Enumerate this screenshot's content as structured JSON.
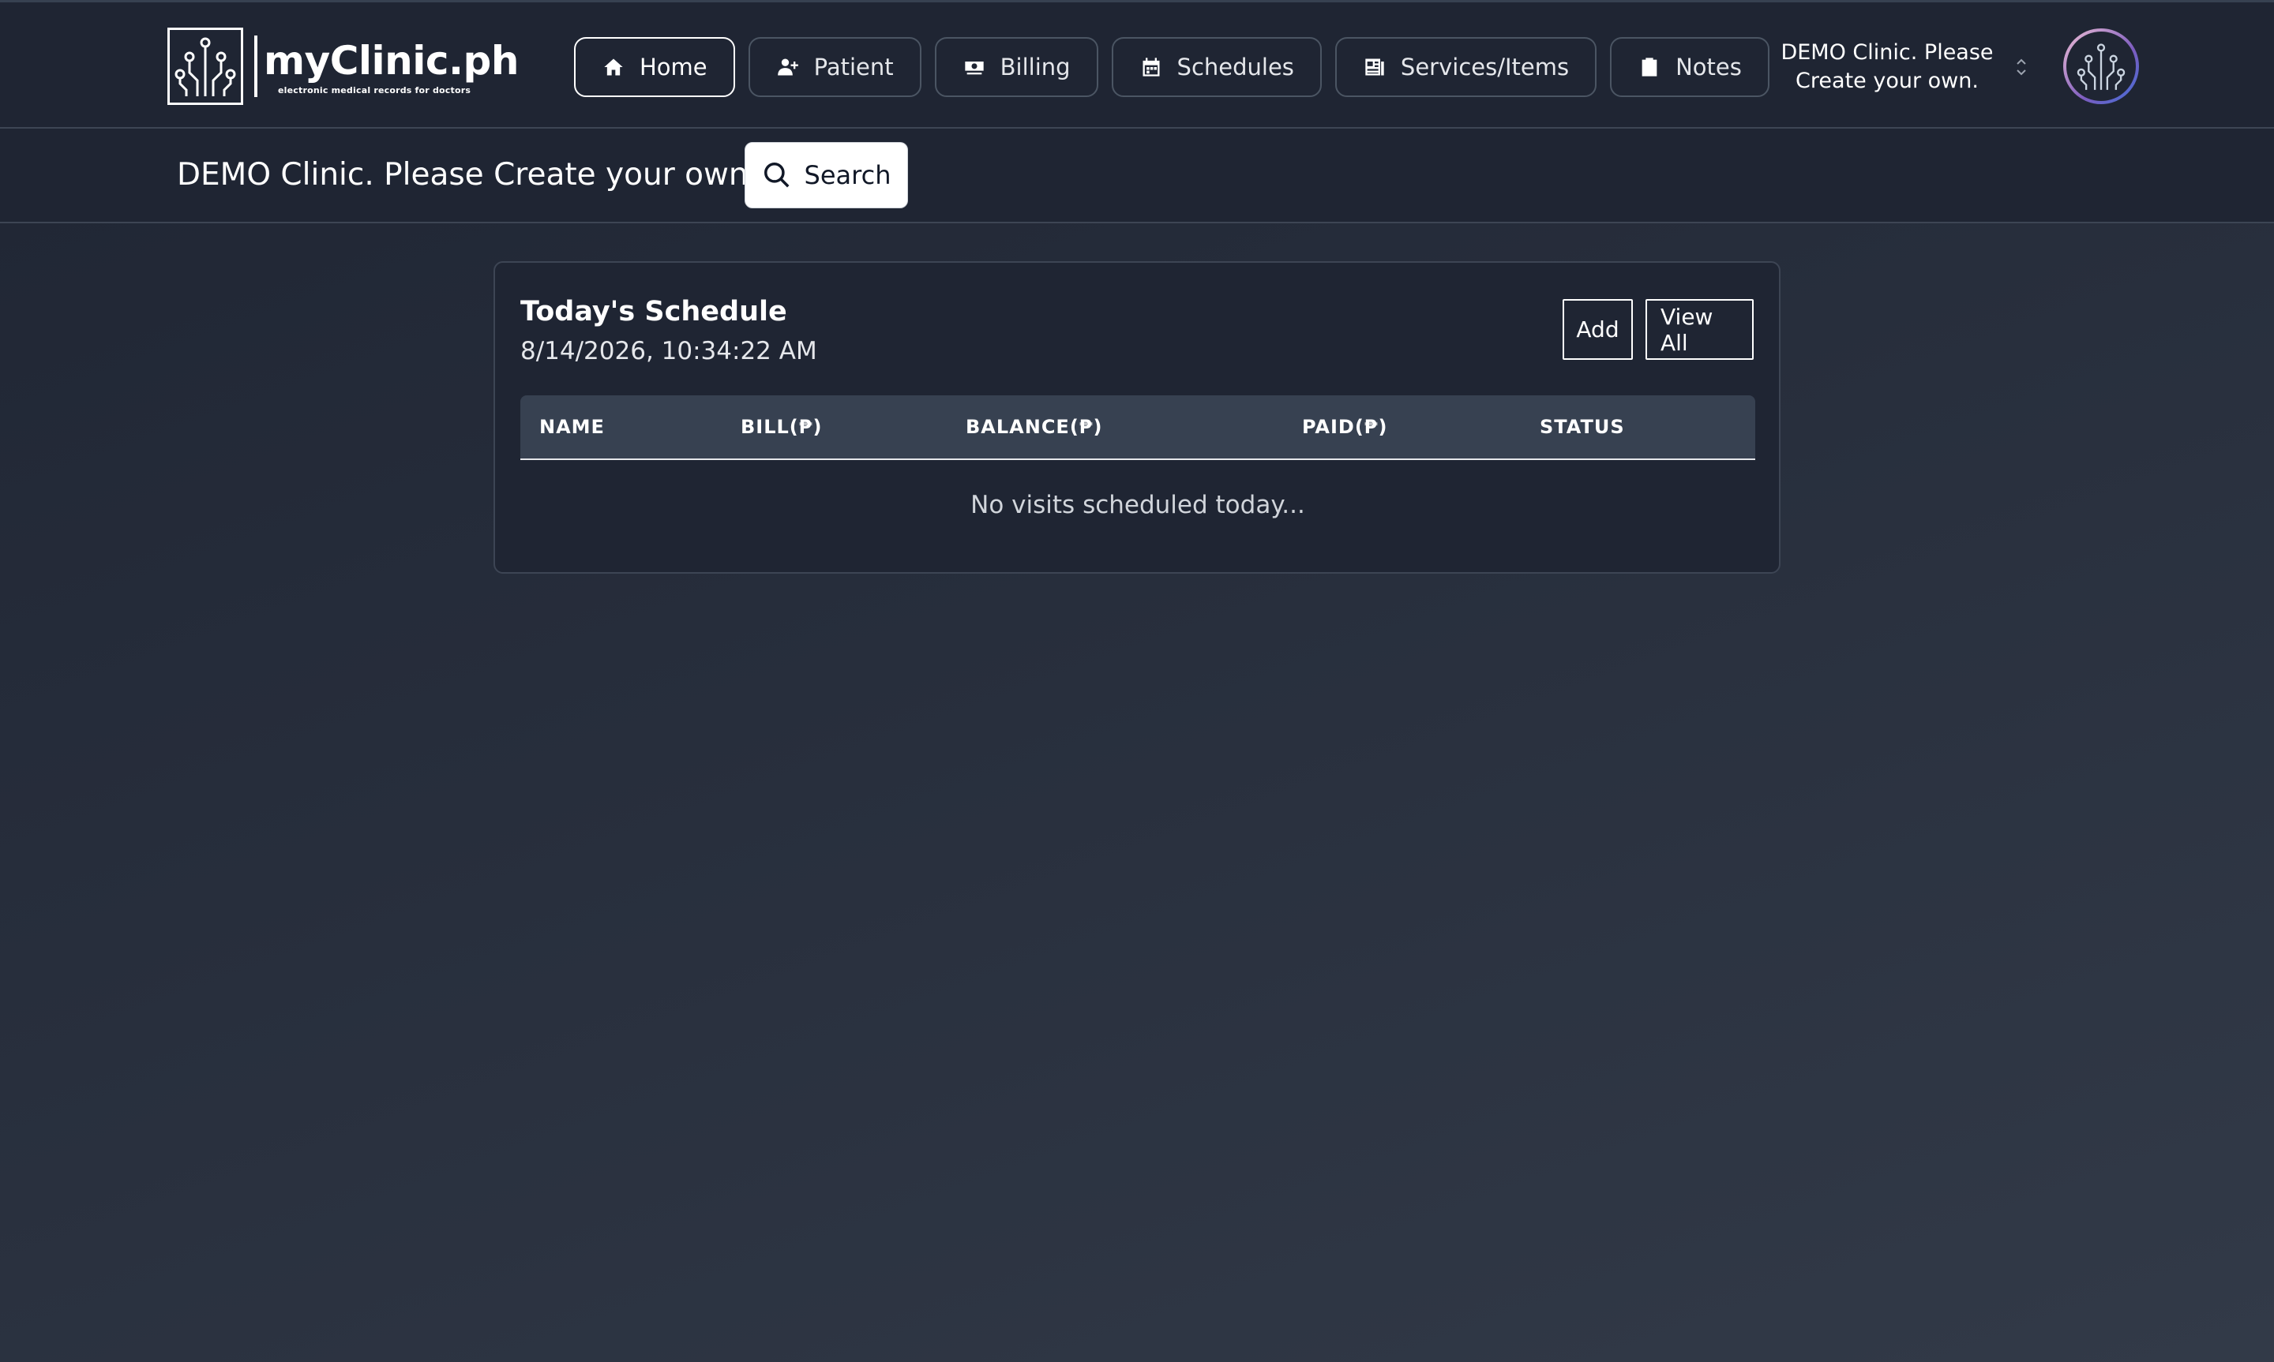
{
  "brand": {
    "name": "myClinic.ph",
    "tagline": "electronic medical records for doctors"
  },
  "nav": {
    "tabs": [
      {
        "label": "Home",
        "icon": "home-icon",
        "active": true
      },
      {
        "label": "Patient",
        "icon": "user-plus-icon",
        "active": false
      },
      {
        "label": "Billing",
        "icon": "money-icon",
        "active": false
      },
      {
        "label": "Schedules",
        "icon": "calendar-icon",
        "active": false
      },
      {
        "label": "Services/Items",
        "icon": "list-card-icon",
        "active": false
      },
      {
        "label": "Notes",
        "icon": "clipboard-icon",
        "active": false
      }
    ],
    "clinic_selector": {
      "line1": "DEMO Clinic. Please",
      "line2": "Create your own."
    }
  },
  "subheader": {
    "title": "DEMO Clinic. Please Create your own.",
    "search_label": "Search"
  },
  "schedule": {
    "title": "Today's Schedule",
    "datetime": "8/14/2026, 10:34:22 AM",
    "add_label": "Add",
    "view_all_label": "View All",
    "columns": [
      "NAME",
      "BILL(₱)",
      "BALANCE(₱)",
      "PAID(₱)",
      "STATUS"
    ],
    "empty_message": "No visits scheduled today..."
  },
  "colors": {
    "background": "#1f2533",
    "table_header": "#374151",
    "border": "#3d4554",
    "text": "#ffffff"
  }
}
